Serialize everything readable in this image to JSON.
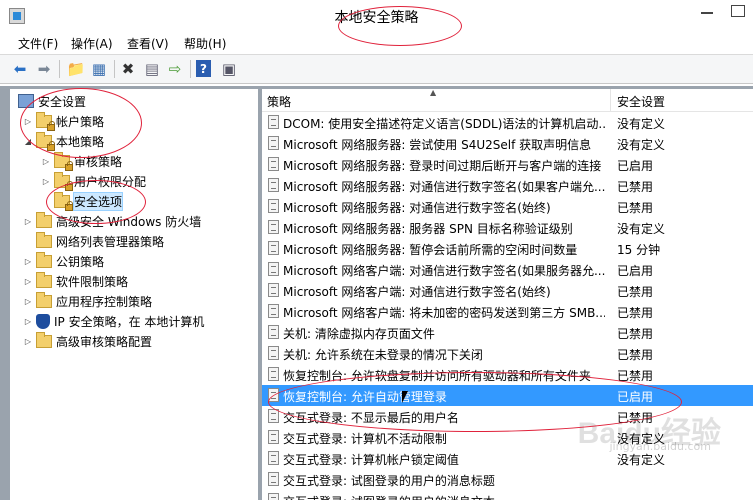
{
  "window": {
    "title": "本地安全策略"
  },
  "menu": [
    "文件(F)",
    "操作(A)",
    "查看(V)",
    "帮助(H)"
  ],
  "toolbar": {
    "buttons": [
      "back-icon",
      "forward-icon",
      "up-folder-icon",
      "show-tree-icon",
      "delete-icon",
      "properties-icon",
      "export-icon",
      "help-icon",
      "console-icon"
    ]
  },
  "tree": {
    "items": [
      {
        "label": "安全设置",
        "expanded": true
      },
      {
        "label": "帐户策略"
      },
      {
        "label": "本地策略",
        "expanded": true
      },
      {
        "label": "审核策略"
      },
      {
        "label": "用户权限分配"
      },
      {
        "label": "安全选项",
        "selected": true
      },
      {
        "label": "高级安全 Windows 防火墙"
      },
      {
        "label": "网络列表管理器策略"
      },
      {
        "label": "公钥策略"
      },
      {
        "label": "软件限制策略"
      },
      {
        "label": "应用程序控制策略"
      },
      {
        "label": "IP 安全策略，在 本地计算机"
      },
      {
        "label": "高级审核策略配置"
      }
    ]
  },
  "list": {
    "columns": [
      "策略",
      "安全设置"
    ],
    "rows": [
      {
        "policy": "DCOM: 使用安全描述符定义语言(SDDL)语法的计算机启动...",
        "setting": "没有定义"
      },
      {
        "policy": "Microsoft 网络服务器: 尝试使用 S4U2Self 获取声明信息",
        "setting": "没有定义"
      },
      {
        "policy": "Microsoft 网络服务器: 登录时间过期后断开与客户端的连接",
        "setting": "已启用"
      },
      {
        "policy": "Microsoft 网络服务器: 对通信进行数字签名(如果客户端允...",
        "setting": "已禁用"
      },
      {
        "policy": "Microsoft 网络服务器: 对通信进行数字签名(始终)",
        "setting": "已禁用"
      },
      {
        "policy": "Microsoft 网络服务器: 服务器 SPN 目标名称验证级别",
        "setting": "没有定义"
      },
      {
        "policy": "Microsoft 网络服务器: 暂停会话前所需的空闲时间数量",
        "setting": "15 分钟"
      },
      {
        "policy": "Microsoft 网络客户端: 对通信进行数字签名(如果服务器允...",
        "setting": "已启用"
      },
      {
        "policy": "Microsoft 网络客户端: 对通信进行数字签名(始终)",
        "setting": "已禁用"
      },
      {
        "policy": "Microsoft 网络客户端: 将未加密的密码发送到第三方 SMB...",
        "setting": "已禁用"
      },
      {
        "policy": "关机: 清除虚拟内存页面文件",
        "setting": "已禁用"
      },
      {
        "policy": "关机: 允许系统在未登录的情况下关闭",
        "setting": "已禁用"
      },
      {
        "policy": "恢复控制台: 允许软盘复制并访问所有驱动器和所有文件夹",
        "setting": "已禁用"
      },
      {
        "policy": "恢复控制台: 允许自动管理登录",
        "setting": "已启用",
        "selected": true
      },
      {
        "policy": "交互式登录: 不显示最后的用户名",
        "setting": "已禁用"
      },
      {
        "policy": "交互式登录: 计算机不活动限制",
        "setting": "没有定义"
      },
      {
        "policy": "交互式登录: 计算机帐户锁定阈值",
        "setting": "没有定义"
      },
      {
        "policy": "交互式登录: 试图登录的用户的消息标题",
        "setting": ""
      },
      {
        "policy": "交互式登录: 试图登录的用户的消息文本",
        "setting": ""
      }
    ]
  },
  "watermark": {
    "text": "Baidu经验",
    "sub": "jingyan.baidu.com"
  },
  "colors": {
    "selection": "#3399ff",
    "annotation": "#e0223b"
  }
}
